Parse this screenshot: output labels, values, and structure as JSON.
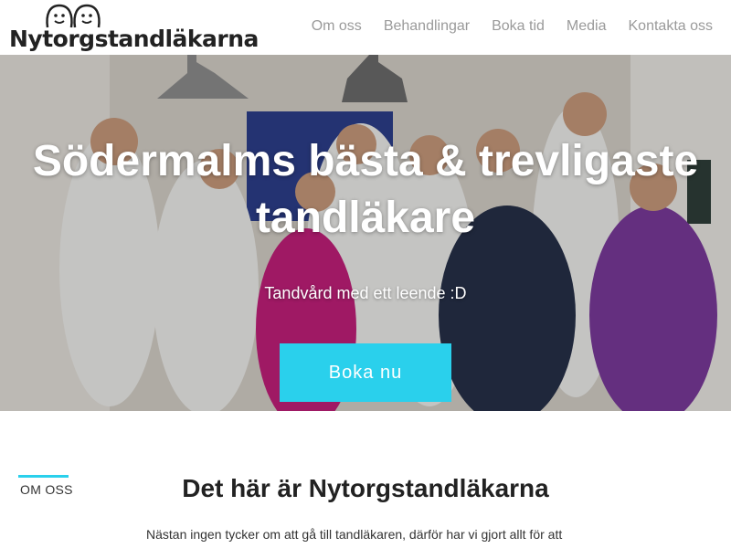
{
  "brand": {
    "name": "Nytorgstandläkarna",
    "accent_color": "#2ad0ec"
  },
  "nav": {
    "items": [
      {
        "label": "Om oss"
      },
      {
        "label": "Behandlingar"
      },
      {
        "label": "Boka tid"
      },
      {
        "label": "Media"
      },
      {
        "label": "Kontakta oss"
      }
    ]
  },
  "hero": {
    "title": "Södermalms bästa & trevligaste tandläkare",
    "subtitle": "Tandvård med ett leende :D",
    "button_label": "Boka nu"
  },
  "about": {
    "tag": "OM OSS",
    "title": "Det här är Nytorgstandläkarna",
    "text": "Nästan ingen tycker om att gå till tandläkaren, därför har vi gjort allt för att"
  }
}
